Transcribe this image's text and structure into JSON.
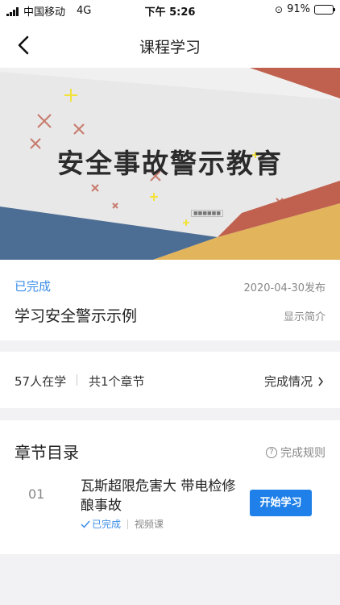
{
  "status_bar": {
    "carrier": "中国移动",
    "network": "4G",
    "time": "下午 5:26",
    "battery_percent": "91%",
    "battery_level": 0.91
  },
  "nav": {
    "title": "课程学习",
    "back_icon": "chevron-left-icon"
  },
  "banner": {
    "headline": "安全事故警示教育"
  },
  "course": {
    "status": "已完成",
    "publish_date": "2020-04-30发布",
    "title": "学习安全警示示例",
    "intro_link": "显示简介"
  },
  "stats": {
    "learners": "57人在学",
    "chapters": "共1个章节",
    "completion_link": "完成情况"
  },
  "toc": {
    "title": "章节目录",
    "rules_link": "完成规则",
    "chapters": [
      {
        "number": "01",
        "title": "瓦斯超限危害大 带电检修酿事故",
        "status": "已完成",
        "type": "视频课",
        "action": "开始学习"
      }
    ]
  },
  "colors": {
    "accent": "#1e80e8",
    "status_blue": "#3b8ee8",
    "banner_red": "#c0614f",
    "banner_blue": "#4d6e94",
    "banner_yellow": "#e2b45c"
  }
}
